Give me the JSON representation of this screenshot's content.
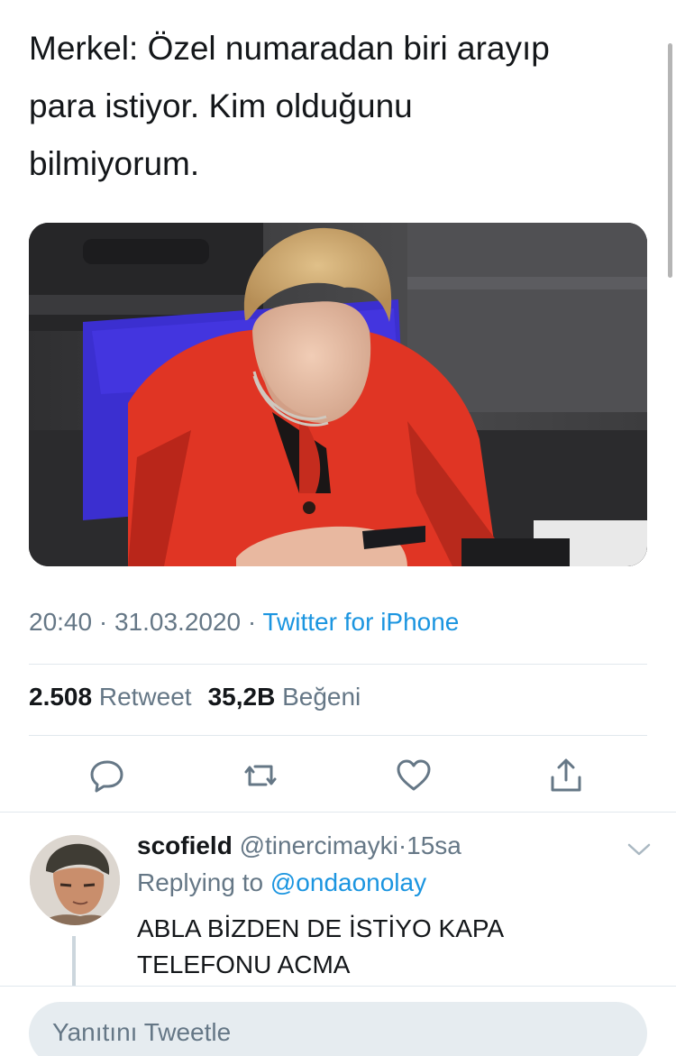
{
  "tweet": {
    "text": "Merkel: Özel numaradan biri arayıp\npara istiyor. Kim olduğunu\nbilmiyorum.",
    "time": "20:40",
    "date": "31.03.2020",
    "separator": "·",
    "source": "Twitter for iPhone",
    "retweet_count": "2.508",
    "retweet_label": "Retweet",
    "like_count": "35,2B",
    "like_label": "Beğeni"
  },
  "actions": {
    "reply_icon": "reply-icon",
    "retweet_icon": "retweet-icon",
    "like_icon": "heart-icon",
    "share_icon": "share-icon"
  },
  "reply": {
    "display_name": "scofield",
    "handle": "@tinercimayki",
    "separator": "·",
    "age": "15sa",
    "replying_prefix": "Replying to",
    "replying_to": "@ondaonolay",
    "body": "ABLA BİZDEN DE İSTİYO KAPA TELEFONU ACMA"
  },
  "composer": {
    "placeholder": "Yanıtını Tweetle"
  },
  "colors": {
    "link": "#1b95e0",
    "secondary": "#657786",
    "divider": "#e1e8ed",
    "composer_bg": "#e6ecf0"
  }
}
